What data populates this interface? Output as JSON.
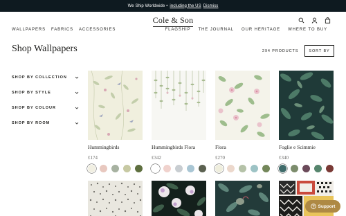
{
  "announcement": {
    "text": "We Ship Worldwide •",
    "link": "including the US",
    "dismiss": "Dismiss"
  },
  "logo": "Cole & Son",
  "header_icons": [
    "search-icon",
    "account-icon",
    "bag-icon"
  ],
  "nav": {
    "left": [
      "WALLPAPERS",
      "FABRICS",
      "ACCESSORIES"
    ],
    "right": [
      "FLAGSHIP",
      "THE JOURNAL",
      "OUR HERITAGE",
      "WHERE TO BUY"
    ]
  },
  "page_title": "Shop Wallpapers",
  "product_count": "294 PRODUCTS",
  "sort_label": "SORT BY",
  "filters": [
    "SHOP BY COLLECTION",
    "SHOP BY STYLE",
    "SHOP BY COLOUR",
    "SHOP BY ROOM"
  ],
  "products": [
    {
      "name": "Hummingbirds",
      "price": "£174",
      "swatches": [
        "#f1efe2",
        "#e8c8bf",
        "#a7b2a1",
        "#c7c9a3",
        "#5e6f3f"
      ],
      "selected": 0
    },
    {
      "name": "Hummingbirds Flora",
      "price": "£342",
      "swatches": [
        "#ffffff",
        "#f0d2cd",
        "#c8cdd1",
        "#a9c6d4",
        "#5b6150"
      ],
      "selected": 0
    },
    {
      "name": "Flora",
      "price": "£270",
      "swatches": [
        "#efeedd",
        "#ecd8cc",
        "#b5c2a8",
        "#9dc3c5",
        "#74875a"
      ],
      "selected": 0
    },
    {
      "name": "Foglie e Scimmie",
      "price": "£340",
      "swatches": [
        "#3f6b6a",
        "#7c8c6c",
        "#6b4a5a",
        "#56856d",
        "#7a3a36"
      ],
      "selected": 0
    }
  ],
  "support_label": "Support",
  "colors": {
    "announcement_bg": "#0e1a20",
    "support_bg": "#ae8944"
  }
}
